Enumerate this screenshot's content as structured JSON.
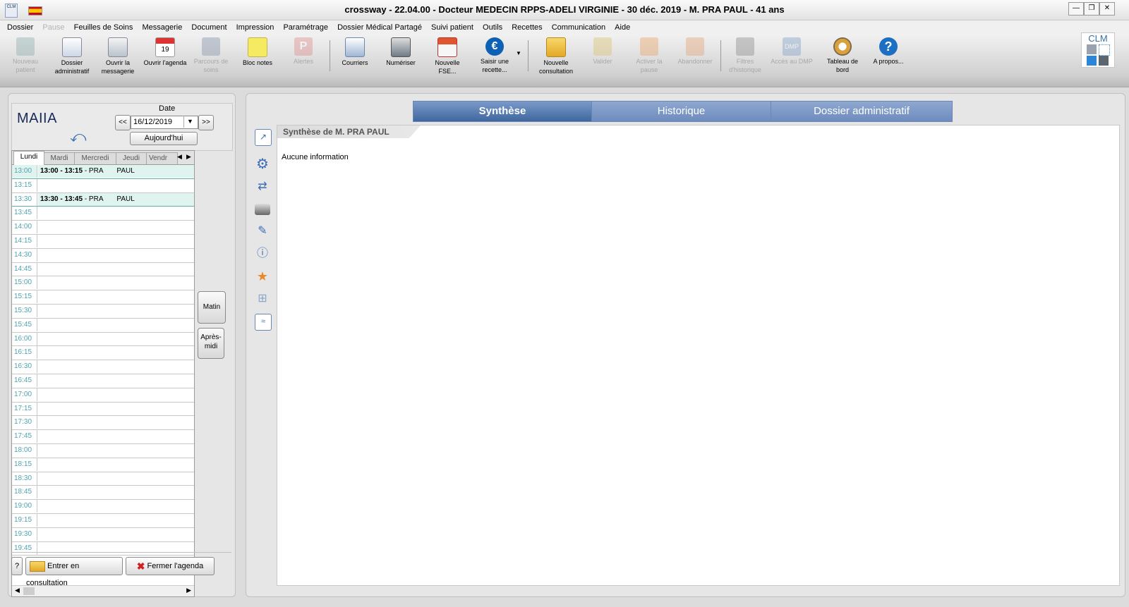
{
  "window": {
    "title": "crossway  - 22.04.00 - Docteur MEDECIN RPPS-ADELI VIRGINIE - 30 déc. 2019 - M. PRA          PAUL - 41 ans",
    "app_icon_text": "CLM"
  },
  "menu": [
    "Dossier",
    "Pause",
    "Feuilles de Soins",
    "Messagerie",
    "Document",
    "Impression",
    "Paramétrage",
    "Dossier Médical Partagé",
    "Suivi patient",
    "Outils",
    "Recettes",
    "Communication",
    "Aide"
  ],
  "toolbar": [
    {
      "label": "Nouveau patient",
      "icon": "new-patient-icon",
      "disabled": true
    },
    {
      "label": "Dossier administratif",
      "icon": "admin-folder-icon",
      "disabled": false
    },
    {
      "label": "Ouvrir la messagerie",
      "icon": "mail-icon",
      "disabled": false
    },
    {
      "label": "Ouvrir l'agenda",
      "icon": "calendar-icon",
      "disabled": false
    },
    {
      "label": "Parcours de soins",
      "icon": "care-path-icon",
      "disabled": true
    },
    {
      "label": "Bloc notes",
      "icon": "notepad-icon",
      "disabled": false
    },
    {
      "label": "Alertes",
      "icon": "alert-icon",
      "disabled": true
    },
    {
      "label": "Courriers",
      "icon": "letter-icon",
      "disabled": false
    },
    {
      "label": "Numériser",
      "icon": "scanner-icon",
      "disabled": false
    },
    {
      "label": "Nouvelle FSE...",
      "icon": "fse-icon",
      "disabled": false
    },
    {
      "label": "Saisir une recette...",
      "icon": "euro-icon",
      "disabled": false
    },
    {
      "label": "Nouvelle consultation",
      "icon": "new-consultation-icon",
      "disabled": false
    },
    {
      "label": "Valider",
      "icon": "validate-icon",
      "disabled": true
    },
    {
      "label": "Activer la pause",
      "icon": "pause-icon",
      "disabled": true
    },
    {
      "label": "Abandonner",
      "icon": "abandon-icon",
      "disabled": true
    },
    {
      "label": "Filtres d'historique",
      "icon": "history-filter-icon",
      "disabled": true
    },
    {
      "label": "Accès au DMP",
      "icon": "dmp-icon",
      "disabled": true
    },
    {
      "label": "Tableau de bord",
      "icon": "dashboard-icon",
      "disabled": false
    },
    {
      "label": "A propos...",
      "icon": "help-icon",
      "disabled": false
    }
  ],
  "logo_text": "CLM",
  "agenda": {
    "brand": "MAIIA",
    "date_label": "Date",
    "date_value": "16/12/2019",
    "prev_label": "<<",
    "next_label": ">>",
    "today_label": "Aujourd'hui",
    "days": [
      "Lundi",
      "Mardi",
      "Mercredi",
      "Jeudi",
      "Vendr"
    ],
    "slots": [
      {
        "time": "13:00",
        "appt_time": "13:00 - 13:15",
        "appt_name": " - PRA       PAUL"
      },
      {
        "time": "13:15",
        "appt_time": "",
        "appt_name": ""
      },
      {
        "time": "13:30",
        "appt_time": "13:30 - 13:45",
        "appt_name": " - PRA       PAUL"
      },
      {
        "time": "13:45"
      },
      {
        "time": "14:00"
      },
      {
        "time": "14:15"
      },
      {
        "time": "14:30"
      },
      {
        "time": "14:45"
      },
      {
        "time": "15:00"
      },
      {
        "time": "15:15"
      },
      {
        "time": "15:30"
      },
      {
        "time": "15:45"
      },
      {
        "time": "16:00"
      },
      {
        "time": "16:15"
      },
      {
        "time": "16:30"
      },
      {
        "time": "16:45"
      },
      {
        "time": "17:00"
      },
      {
        "time": "17:15"
      },
      {
        "time": "17:30"
      },
      {
        "time": "17:45"
      },
      {
        "time": "18:00"
      },
      {
        "time": "18:15"
      },
      {
        "time": "18:30"
      },
      {
        "time": "18:45"
      },
      {
        "time": "19:00"
      },
      {
        "time": "19:15"
      },
      {
        "time": "19:30"
      },
      {
        "time": "19:45"
      }
    ],
    "morning_label": "Matin",
    "afternoon_label": "Après-midi",
    "help_label": "?",
    "enter_consultation_label": "Entrer en consultation",
    "close_agenda_label": "Fermer l'agenda"
  },
  "main": {
    "tabs": [
      "Synthèse",
      "Historique",
      "Dossier administratif"
    ],
    "active_tab": 0,
    "synthesis_header": "Synthèse de M. PRA        PAUL",
    "empty_text": "Aucune information"
  }
}
